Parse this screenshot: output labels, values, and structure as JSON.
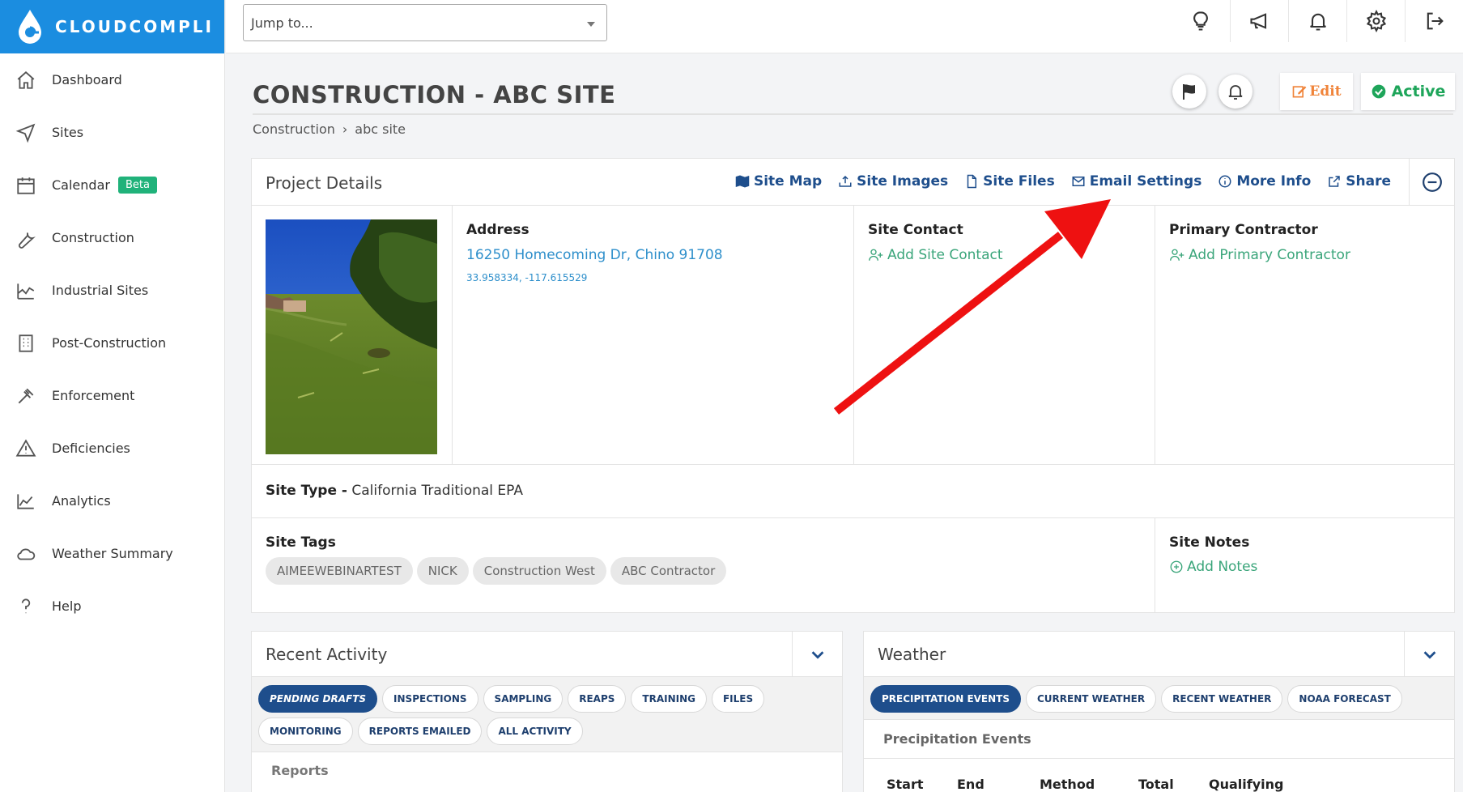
{
  "brand": {
    "name": "CLOUDCOMPLI"
  },
  "sidebar": {
    "items": [
      {
        "label": "Dashboard",
        "icon": "home-icon"
      },
      {
        "label": "Sites",
        "icon": "navigation-arrow-icon"
      },
      {
        "label": "Calendar",
        "icon": "calendar-icon",
        "badge": "Beta"
      },
      {
        "label": "Construction",
        "icon": "wrench-icon"
      },
      {
        "label": "Industrial Sites",
        "icon": "factory-icon"
      },
      {
        "label": "Post-Construction",
        "icon": "building-icon"
      },
      {
        "label": "Enforcement",
        "icon": "gavel-icon"
      },
      {
        "label": "Deficiencies",
        "icon": "warning-triangle-icon"
      },
      {
        "label": "Analytics",
        "icon": "area-chart-icon"
      },
      {
        "label": "Weather Summary",
        "icon": "cloud-icon"
      },
      {
        "label": "Help",
        "icon": "question-icon"
      }
    ]
  },
  "topbar": {
    "jump_placeholder": "Jump to...",
    "icons": [
      "lightbulb-icon",
      "megaphone-icon",
      "bell-icon",
      "gear-icon",
      "logout-icon"
    ]
  },
  "page": {
    "title": "CONSTRUCTION - ABC SITE",
    "breadcrumb": [
      "Construction",
      "abc site"
    ],
    "breadcrumb_sep": "›",
    "edit_label": "Edit",
    "status_label": "Active"
  },
  "project": {
    "title": "Project Details",
    "links": [
      "Site Map",
      "Site Images",
      "Site Files",
      "Email Settings",
      "More Info",
      "Share"
    ],
    "address_heading": "Address",
    "address": "16250 Homecoming Dr, Chino 91708",
    "coordinates": "33.958334, -117.615529",
    "site_contact_heading": "Site Contact",
    "add_site_contact": "Add Site Contact",
    "primary_contractor_heading": "Primary Contractor",
    "add_primary_contractor": "Add Primary Contractor",
    "site_type_label": "Site Type -",
    "site_type_value": "California Traditional EPA",
    "site_tags_heading": "Site Tags",
    "tags": [
      "AIMEEWEBINARTEST",
      "NICK",
      "Construction West",
      "ABC Contractor"
    ],
    "site_notes_heading": "Site Notes",
    "add_notes": "Add Notes"
  },
  "recent_activity": {
    "title": "Recent Activity",
    "pills": [
      "PENDING DRAFTS",
      "INSPECTIONS",
      "SAMPLING",
      "REAPS",
      "TRAINING",
      "FILES",
      "MONITORING",
      "REPORTS EMAILED",
      "ALL ACTIVITY"
    ],
    "active_pill": "PENDING DRAFTS",
    "section": "Reports"
  },
  "weather": {
    "title": "Weather",
    "pills": [
      "PRECIPITATION EVENTS",
      "CURRENT WEATHER",
      "RECENT WEATHER",
      "NOAA FORECAST"
    ],
    "active_pill": "PRECIPITATION EVENTS",
    "section": "Precipitation Events",
    "columns": [
      "Start",
      "End",
      "Method",
      "Total",
      "Qualifying"
    ]
  },
  "colors": {
    "brand_blue": "#1b8de0",
    "link_navy": "#1e4e8c",
    "link_blue": "#2e8fcb",
    "add_green": "#3aa57a",
    "status_green": "#1ea55a",
    "edit_orange": "#f0843a",
    "annotation_red": "#ee1111"
  }
}
